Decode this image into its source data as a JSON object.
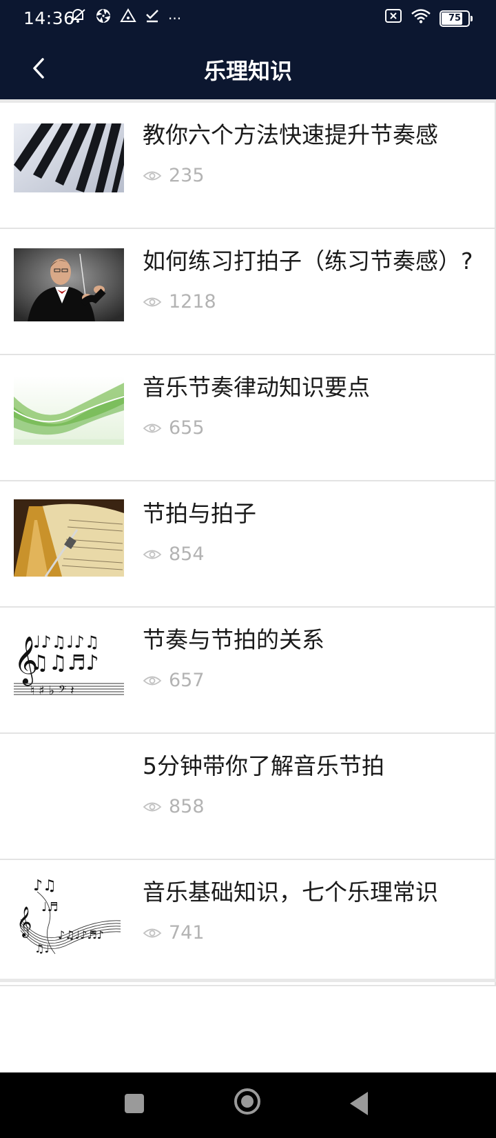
{
  "status_bar": {
    "time": "14:36",
    "left_icons": [
      "mute-icon",
      "aperture-icon",
      "warning-triangle-icon",
      "check-icon",
      "more-dots-icon"
    ],
    "more": "···",
    "battery": "75"
  },
  "header": {
    "title": "乐理知识",
    "background": "#0c1730"
  },
  "articles": [
    {
      "title": "教你六个方法快速提升节奏感",
      "views": "235",
      "thumb": "piano-keys-image"
    },
    {
      "title": "如何练习打拍子（练习节奏感）?",
      "views": "1218",
      "thumb": "conductor-image"
    },
    {
      "title": "音乐节奏律动知识要点",
      "views": "655",
      "thumb": "green-wave-image"
    },
    {
      "title": "节拍与拍子",
      "views": "854",
      "thumb": "metronome-image"
    },
    {
      "title": "节奏与节拍的关系",
      "views": "657",
      "thumb": "music-notes-image"
    },
    {
      "title": "5分钟带你了解音乐节拍",
      "views": "858",
      "thumb": "blank-image"
    },
    {
      "title": "音乐基础知识，七个乐理常识",
      "views": "741",
      "thumb": "music-swirl-image"
    }
  ],
  "colors": {
    "title_text": "#1a1a1a",
    "meta_text": "#b3b3b3",
    "divider": "#e3e3e3"
  }
}
